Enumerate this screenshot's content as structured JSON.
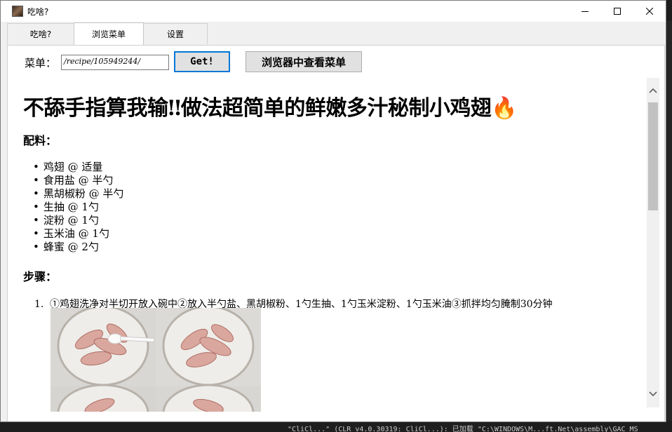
{
  "window": {
    "title": "吃啥?"
  },
  "tabs": [
    {
      "label": "吃啥?"
    },
    {
      "label": "浏览菜单"
    },
    {
      "label": "设置"
    }
  ],
  "toolbar": {
    "menu_label": "菜单：",
    "url_value": "/recipe/105949244/",
    "get_label": "Get!",
    "browser_label": "浏览器中查看菜单"
  },
  "recipe": {
    "title": "不舔手指算我输‼做法超简单的鲜嫩多汁秘制小鸡翅🔥",
    "ingredients_heading": "配料：",
    "ingredients": [
      "鸡翅  @ 适量",
      "食用盐  @ 半勺",
      "黑胡椒粉  @ 半勺",
      "生抽  @ 1勺",
      "淀粉  @ 1勺",
      "玉米油  @ 1勺",
      "蜂蜜  @ 2勺"
    ],
    "steps_heading": "步骤：",
    "steps": [
      {
        "num": "1.",
        "text": "①鸡翅洗净对半切开放入碗中②放入半勺盐、黑胡椒粉、1勺生抽、1勺玉米淀粉、1勺玉米油③抓拌均匀腌制30分钟"
      }
    ]
  },
  "background": {
    "terminal_text": "\"CliCl...\" (CLR v4.0.30319: CliCl...): 已加载 \"C:\\WINDOWS\\M...ft.Net\\assembly\\GAC_MS"
  }
}
